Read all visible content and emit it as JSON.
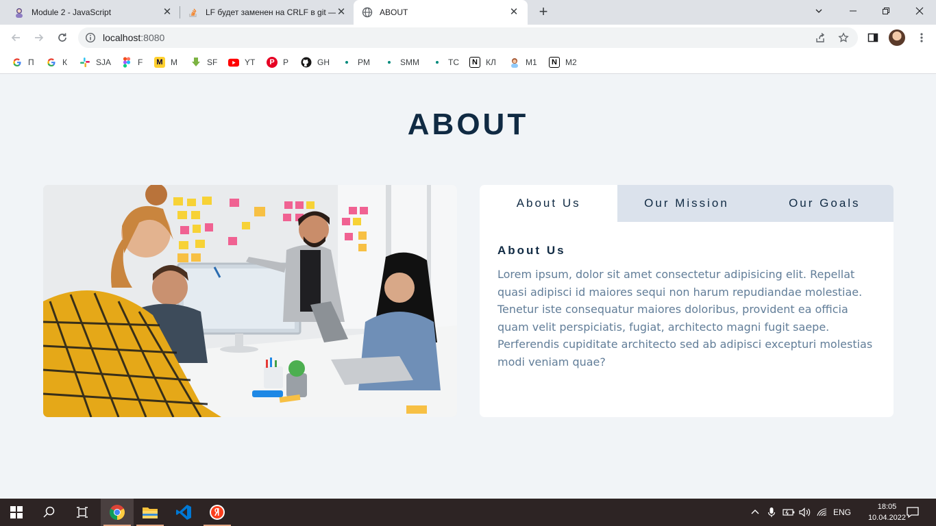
{
  "browser": {
    "tabs": [
      {
        "title": "Module 2 - JavaScript",
        "icon": "avatar-icon"
      },
      {
        "title": "LF будет заменен на CRLF в git — ч",
        "icon": "stackoverflow-icon"
      },
      {
        "title": "ABOUT",
        "icon": "globe-icon"
      }
    ],
    "url_host": "localhost",
    "url_port": ":8080",
    "bookmarks": [
      {
        "label": "П",
        "icon": "google-icon"
      },
      {
        "label": "К",
        "icon": "google-icon"
      },
      {
        "label": "SJA",
        "icon": "slack-icon"
      },
      {
        "label": "F",
        "icon": "figma-icon"
      },
      {
        "label": "M",
        "icon": "miro-icon"
      },
      {
        "label": "SF",
        "icon": "download-icon"
      },
      {
        "label": "YT",
        "icon": "youtube-icon"
      },
      {
        "label": "P",
        "icon": "pinterest-icon"
      },
      {
        "label": "GH",
        "icon": "github-icon"
      },
      {
        "label": "PM",
        "icon": "dot-icon"
      },
      {
        "label": "SMM",
        "icon": "dot-icon"
      },
      {
        "label": "TC",
        "icon": "dot-icon"
      },
      {
        "label": "КЛ",
        "icon": "notion-icon"
      },
      {
        "label": "M1",
        "icon": "avatar-icon"
      },
      {
        "label": "M2",
        "icon": "notion-icon"
      }
    ]
  },
  "page": {
    "title": "ABOUT",
    "tabs": [
      "About Us",
      "Our Mission",
      "Our Goals"
    ],
    "active_tab": "About Us",
    "content_heading": "About Us",
    "content_text": "Lorem ipsum, dolor sit amet consectetur adipisicing elit. Repellat quasi adipisci id maiores sequi non harum repudiandae molestiae. Tenetur iste consequatur maiores doloribus, provident ea officia quam velit perspiciatis, fugiat, architecto magni fugit saepe. Perferendis cupiditate architecto sed ab adipisci excepturi molestias modi veniam quae?"
  },
  "taskbar": {
    "language": "ENG",
    "time": "18:05",
    "date": "10.04.2022"
  },
  "colors": {
    "heading": "#102a43",
    "body_text": "#617d98",
    "page_bg": "#f1f4f7",
    "tab_inactive_bg": "#dbe2ec"
  }
}
